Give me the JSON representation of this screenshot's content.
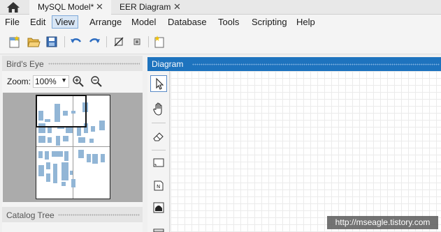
{
  "tabs": [
    {
      "label": "MySQL Model*",
      "active": true
    },
    {
      "label": "EER Diagram",
      "active": false
    }
  ],
  "menu": [
    "File",
    "Edit",
    "View",
    "Arrange",
    "Model",
    "Database",
    "Tools",
    "Scripting",
    "Help"
  ],
  "menu_selected": "View",
  "toolbar_icons": [
    "new-document-icon",
    "open-folder-icon",
    "save-icon",
    "undo-icon",
    "redo-icon",
    "toggle-grid-icon",
    "align-icon",
    "new-diagram-icon"
  ],
  "left_panel": {
    "birds_eye_title": "Bird's Eye",
    "zoom_label": "Zoom:",
    "zoom_value": "100%",
    "catalog_tree_title": "Catalog Tree"
  },
  "diagram": {
    "title": "Diagram",
    "tools": [
      "pointer-icon",
      "hand-icon",
      "eraser-icon",
      "layer-icon",
      "note-icon",
      "image-icon"
    ]
  },
  "watermark": "http://mseagle.tistory.com",
  "colors": {
    "accent": "#1e73be",
    "table_block": "#92b6d6",
    "selected_menu": "#d8e6f5"
  }
}
